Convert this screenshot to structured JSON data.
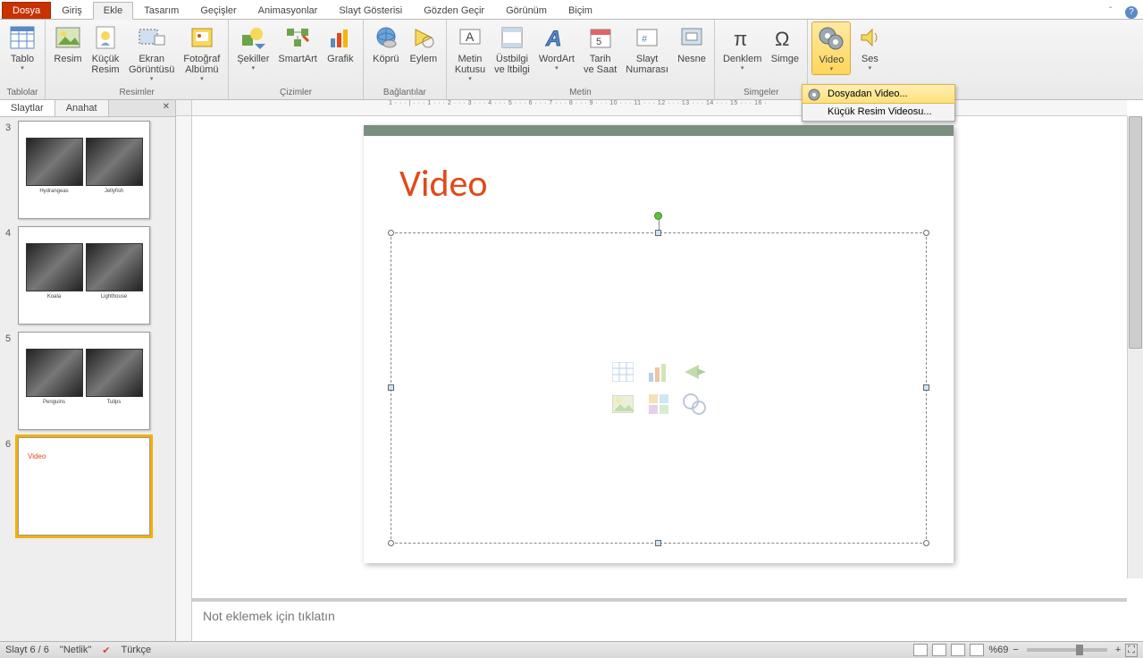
{
  "tabs": {
    "file": "Dosya",
    "home": "Giriş",
    "insert": "Ekle",
    "design": "Tasarım",
    "transitions": "Geçişler",
    "animations": "Animasyonlar",
    "slideshow": "Slayt Gösterisi",
    "review": "Gözden Geçir",
    "view": "Görünüm",
    "format": "Biçim"
  },
  "ribbon": {
    "tables": {
      "table": "Tablo",
      "label": "Tablolar"
    },
    "images": {
      "picture": "Resim",
      "clipart": "Küçük\nResim",
      "screenshot": "Ekran\nGörüntüsü",
      "album": "Fotoğraf\nAlbümü",
      "label": "Resimler"
    },
    "illustrations": {
      "shapes": "Şekiller",
      "smartart": "SmartArt",
      "chart": "Grafik",
      "label": "Çizimler"
    },
    "links": {
      "hyperlink": "Köprü",
      "action": "Eylem",
      "label": "Bağlantılar"
    },
    "text": {
      "textbox": "Metin\nKutusu",
      "headerfooter": "Üstbilgi\nve ltbilgi",
      "wordart": "WordArt",
      "datetime": "Tarih\nve Saat",
      "slidenumber": "Slayt\nNumarası",
      "object": "Nesne",
      "label": "Metin"
    },
    "symbols": {
      "equation": "Denklem",
      "symbol": "Simge",
      "label": "Simgeler"
    },
    "media": {
      "video": "Video",
      "audio": "Ses"
    }
  },
  "dropdown": {
    "fromfile": "Dosyadan Video...",
    "clipart": "Küçük Resim Videosu..."
  },
  "sidepanel": {
    "slides_tab": "Slaytlar",
    "outline_tab": "Anahat",
    "thumbs": [
      {
        "n": "3",
        "img1": "Hydrangeas",
        "img2": "Jellyfish"
      },
      {
        "n": "4",
        "img1": "Koala",
        "img2": "Lighthouse"
      },
      {
        "n": "5",
        "img1": "Penguins",
        "img2": "Tulips"
      }
    ],
    "thumb_active": {
      "n": "6",
      "title": "Video"
    }
  },
  "slide": {
    "title": "Video"
  },
  "ruler": "1 · · · | · · · 1 · · · 2 · · · 3 · · · 4 · · · 5 · · · 6 · · · 7 · · · 8 · · · 9 · · · 10 · · · 11 · · · 12 · · · 13 · · · 14 · · · 15 · · · 16 ·",
  "notes": {
    "placeholder": "Not eklemek için tıklatın"
  },
  "status": {
    "slide": "Slayt 6 / 6",
    "theme": "\"Netlik\"",
    "lang": "Türkçe",
    "zoom": "%69"
  }
}
